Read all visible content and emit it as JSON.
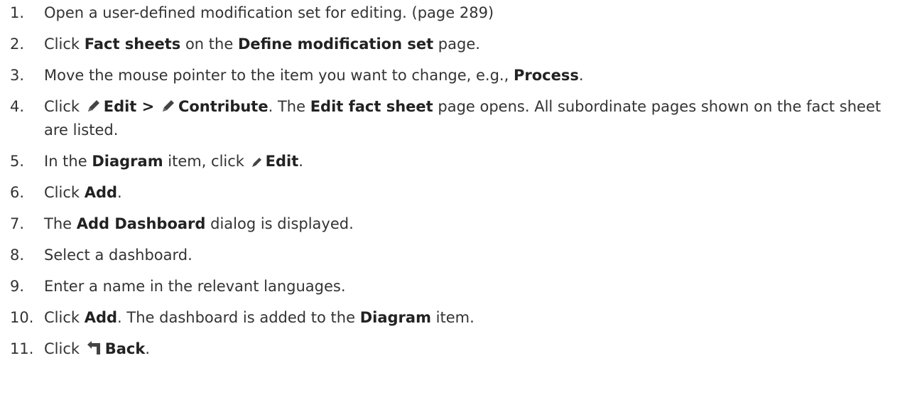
{
  "steps": [
    {
      "num": "1.",
      "parts": [
        {
          "t": "Open a user-defined modification set for editing. (page 289)"
        }
      ]
    },
    {
      "num": "2.",
      "parts": [
        {
          "t": "Click "
        },
        {
          "b": "Fact sheets"
        },
        {
          "t": " on the "
        },
        {
          "b": "Define modification set"
        },
        {
          "t": " page."
        }
      ]
    },
    {
      "num": "3.",
      "parts": [
        {
          "t": "Move the mouse pointer to the item you want to change, e.g., "
        },
        {
          "b": "Process"
        },
        {
          "t": "."
        }
      ]
    },
    {
      "num": "4.",
      "parts": [
        {
          "t": "Click "
        },
        {
          "icon": "pencil-icon"
        },
        {
          "b": "Edit >"
        },
        {
          "t": " "
        },
        {
          "icon": "pencil-icon"
        },
        {
          "b": "Contribute"
        },
        {
          "t": ". The "
        },
        {
          "b": "Edit fact sheet"
        },
        {
          "t": " page opens. All subordinate pages shown on the fact sheet are listed."
        }
      ]
    },
    {
      "num": "5.",
      "parts": [
        {
          "t": "In the "
        },
        {
          "b": "Diagram"
        },
        {
          "t": " item, click "
        },
        {
          "icon": "pencil-small-icon"
        },
        {
          "b": "Edit"
        },
        {
          "t": "."
        }
      ]
    },
    {
      "num": "6.",
      "parts": [
        {
          "t": "Click "
        },
        {
          "b": "Add"
        },
        {
          "t": "."
        }
      ]
    },
    {
      "num": "7.",
      "parts": [
        {
          "t": "The "
        },
        {
          "b": "Add Dashboard"
        },
        {
          "t": " dialog is displayed."
        }
      ]
    },
    {
      "num": "8.",
      "parts": [
        {
          "t": "Select a dashboard."
        }
      ]
    },
    {
      "num": "9.",
      "parts": [
        {
          "t": "Enter a name in the relevant languages."
        }
      ]
    },
    {
      "num": "10.",
      "parts": [
        {
          "t": "Click "
        },
        {
          "b": "Add"
        },
        {
          "t": ". The dashboard is added to the "
        },
        {
          "b": "Diagram"
        },
        {
          "t": " item."
        }
      ]
    },
    {
      "num": "11.",
      "parts": [
        {
          "t": "Click "
        },
        {
          "icon": "back-arrow-icon"
        },
        {
          "b": "Back"
        },
        {
          "t": "."
        }
      ]
    }
  ],
  "colors": {
    "text": "#333333",
    "icon": "#444444"
  }
}
